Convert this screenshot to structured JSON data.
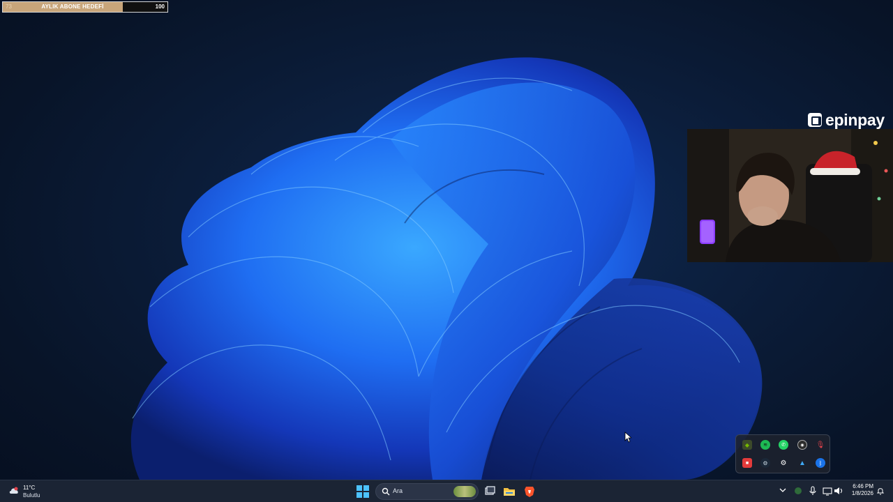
{
  "goal": {
    "current": "73",
    "title": "AYLIK ABONE HEDEFİ",
    "target": "100",
    "progress_fraction": 0.73,
    "fill_color": "#c8a57a"
  },
  "sponsor": {
    "name": "epinpay"
  },
  "taskbar": {
    "weather": {
      "temperature": "11°C",
      "condition": "Bulutlu",
      "icon": "cloud-icon"
    },
    "search": {
      "placeholder": "Ara"
    },
    "apps": [
      "start-icon",
      "task-view-icon",
      "file-explorer-icon",
      "brave-browser-icon"
    ],
    "clock": {
      "time": "6:46 PM",
      "date": "1/8/2026"
    },
    "accent_color": "#4cc2ff"
  },
  "tray_overflow": {
    "icons": [
      "nvidia-icon",
      "spotify-icon",
      "whatsapp-icon",
      "obs-icon",
      "microphone-icon",
      "red-app-icon",
      "steam-icon",
      "settings-icon",
      "warning-icon",
      "bluetooth-icon"
    ]
  }
}
